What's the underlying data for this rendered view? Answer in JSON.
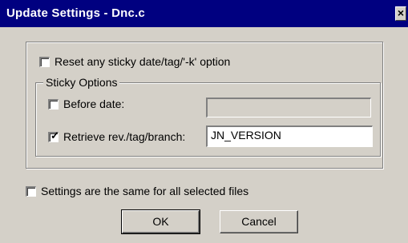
{
  "window": {
    "title": "Update Settings - Dnc.c",
    "close_glyph": "✕"
  },
  "options": {
    "reset_label": "Reset any sticky date/tag/'-k' option",
    "reset_checked": false
  },
  "sticky": {
    "group_label": "Sticky Options",
    "before_date_label": "Before date:",
    "before_date_checked": false,
    "before_date_value": "",
    "retrieve_label": "Retrieve rev./tag/branch:",
    "retrieve_checked": true,
    "retrieve_value": "JN_VERSION"
  },
  "same_for_all": {
    "label": "Settings are the same for all selected files",
    "checked": false
  },
  "buttons": {
    "ok": "OK",
    "cancel": "Cancel"
  },
  "check_glyph": "✓"
}
